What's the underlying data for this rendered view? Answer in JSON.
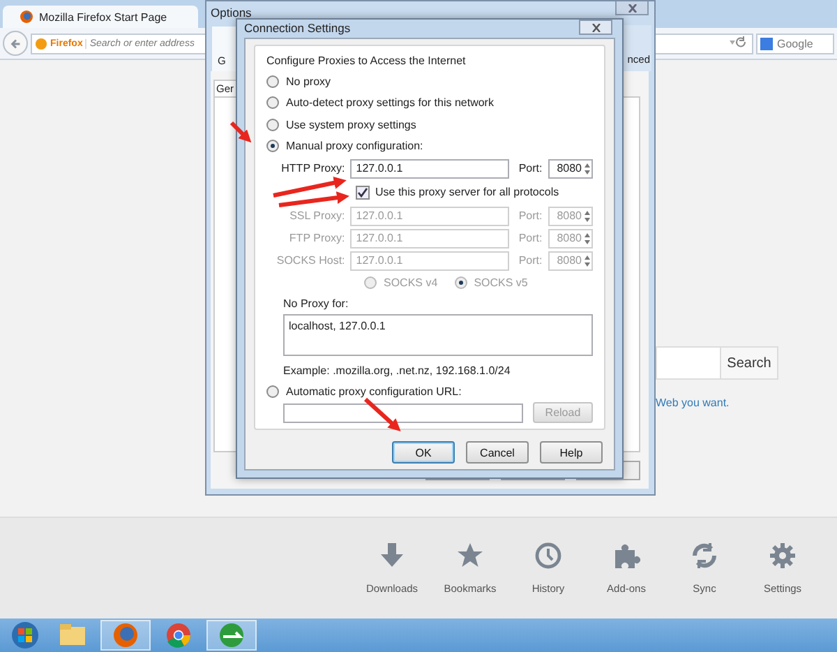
{
  "browser": {
    "tab_title": "Mozilla Firefox Start Page",
    "identity": "Firefox",
    "address_placeholder": "Search or enter address",
    "search_engine_placeholder": "Google",
    "page": {
      "search_button": "Search",
      "link_text": "Web you want."
    },
    "toolbar": [
      {
        "kind": "download",
        "label": "Downloads"
      },
      {
        "kind": "star",
        "label": "Bookmarks"
      },
      {
        "kind": "clock",
        "label": "History"
      },
      {
        "kind": "puzzle",
        "label": "Add-ons"
      },
      {
        "kind": "sync",
        "label": "Sync"
      },
      {
        "kind": "gear",
        "label": "Settings"
      }
    ]
  },
  "options_window": {
    "title": "Options",
    "tabs": [
      {
        "label": "G",
        "selected": false
      },
      {
        "label": "nced",
        "selected": true
      }
    ],
    "panel_tab": "Ger"
  },
  "dialog": {
    "title": "Connection Settings",
    "group_label": "Configure Proxies to Access the Internet",
    "modes": [
      {
        "label": "No proxy",
        "selected": false
      },
      {
        "label": "Auto-detect proxy settings for this network",
        "selected": false
      },
      {
        "label": "Use system proxy settings",
        "selected": false
      },
      {
        "label": "Manual proxy configuration:",
        "selected": true
      }
    ],
    "proxies": [
      {
        "label": "HTTP Proxy:",
        "value": "127.0.0.1",
        "port_label": "Port:",
        "port": "8080",
        "disabled": false
      },
      {
        "label": "SSL Proxy:",
        "value": "127.0.0.1",
        "port_label": "Port:",
        "port": "8080",
        "disabled": true
      },
      {
        "label": "FTP Proxy:",
        "value": "127.0.0.1",
        "port_label": "Port:",
        "port": "8080",
        "disabled": true
      },
      {
        "label": "SOCKS Host:",
        "value": "127.0.0.1",
        "port_label": "Port:",
        "port": "8080",
        "disabled": true
      }
    ],
    "share_all": {
      "label": "Use this proxy server for all protocols",
      "checked": true
    },
    "socks_versions": [
      {
        "label": "SOCKS v4",
        "selected": false,
        "disabled": true
      },
      {
        "label": "SOCKS v5",
        "selected": true,
        "disabled": true
      }
    ],
    "no_proxy": {
      "label": "No Proxy for:",
      "value": "localhost, 127.0.0.1"
    },
    "example": "Example: .mozilla.org, .net.nz, 192.168.1.0/24",
    "auto_url": {
      "label": "Automatic proxy configuration URL:",
      "selected": false,
      "reload": "Reload",
      "reload_disabled": true
    },
    "buttons": [
      {
        "label": "OK",
        "default": true
      },
      {
        "label": "Cancel",
        "default": false
      },
      {
        "label": "Help",
        "default": false
      }
    ]
  },
  "taskbar": [
    {
      "kind": "start",
      "selected": false
    },
    {
      "kind": "folder",
      "selected": false
    },
    {
      "kind": "firefox",
      "selected": true
    },
    {
      "kind": "chrome",
      "selected": false
    },
    {
      "kind": "app",
      "selected": true
    }
  ]
}
